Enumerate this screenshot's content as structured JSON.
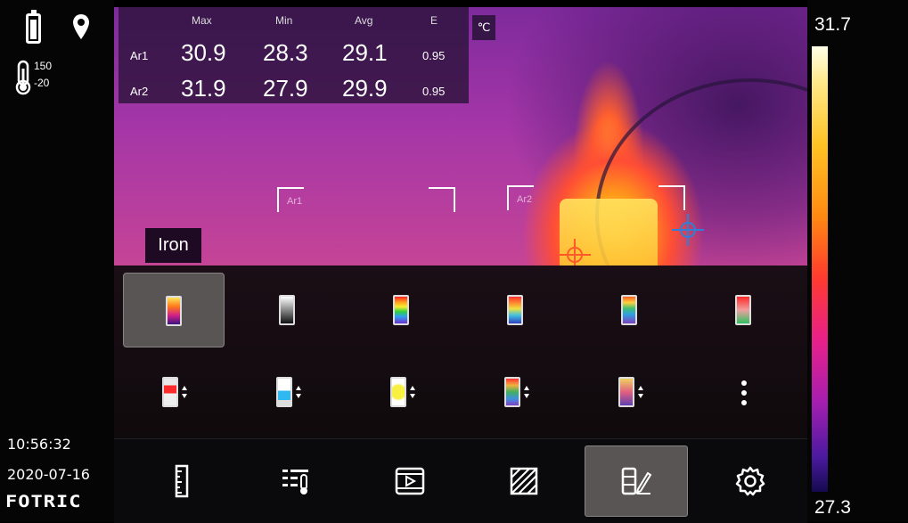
{
  "status": {
    "battery_icon": "battery-icon",
    "gps_icon": "location-pin-icon",
    "range_icon": "thermometer-range-icon",
    "range_high": "150",
    "range_low": "-20",
    "time": "10:56:32",
    "date": "2020-07-16",
    "brand": "FOTRIC"
  },
  "measurements": {
    "headers": [
      "Max",
      "Min",
      "Avg",
      "E"
    ],
    "unit": "℃",
    "rows": [
      {
        "label": "Ar1",
        "max": "30.9",
        "min": "28.3",
        "avg": "29.1",
        "e": "0.95"
      },
      {
        "label": "Ar2",
        "max": "31.9",
        "min": "27.9",
        "avg": "29.9",
        "e": "0.95"
      }
    ]
  },
  "rois": {
    "ar1": "Ar1",
    "ar2": "Ar2"
  },
  "palette": {
    "current_name": "Iron",
    "row1": [
      {
        "name": "iron-palette-icon",
        "selected": true
      },
      {
        "name": "grayscale-palette-icon",
        "selected": false
      },
      {
        "name": "rainbow-palette-icon",
        "selected": false
      },
      {
        "name": "rainbow-hc-palette-icon",
        "selected": false
      },
      {
        "name": "multi-color-palette-icon",
        "selected": false
      },
      {
        "name": "red-green-palette-icon",
        "selected": false
      }
    ],
    "row2": [
      {
        "name": "red-alarm-palette-icon"
      },
      {
        "name": "blue-alarm-palette-icon"
      },
      {
        "name": "yellow-alarm-palette-icon"
      },
      {
        "name": "rainbow-alarm-palette-icon"
      },
      {
        "name": "iron-alarm-palette-icon"
      },
      {
        "name": "more-icon"
      }
    ]
  },
  "toolbar": {
    "items": [
      {
        "name": "measure-ruler-icon",
        "selected": false
      },
      {
        "name": "temperature-settings-icon",
        "selected": false
      },
      {
        "name": "video-playback-icon",
        "selected": false
      },
      {
        "name": "area-hatch-icon",
        "selected": false
      },
      {
        "name": "palette-edit-icon",
        "selected": true
      },
      {
        "name": "settings-gear-icon",
        "selected": false
      }
    ]
  },
  "scale": {
    "max": "31.7",
    "min": "27.3"
  },
  "colors": {
    "selected_bg": "#5a5555",
    "panel_bg": "#1b0e16",
    "crosshair_hot": "#ff5a2a",
    "crosshair_cold": "#2f7fd8"
  }
}
